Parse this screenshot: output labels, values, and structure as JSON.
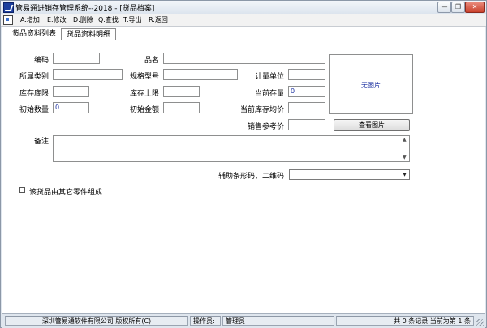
{
  "window": {
    "title": "管易通进销存管理系统--2018 - [货品档案]",
    "minimize_glyph": "—",
    "maximize_glyph": "❐",
    "close_glyph": "✕",
    "icon": "app-logo-icon"
  },
  "menubar": {
    "icon": "document-icon",
    "items": [
      "A.增加",
      "E.修改",
      "D.删除",
      "Q.查找",
      "T.导出",
      "R.返回"
    ]
  },
  "tabs": [
    {
      "label": "货品资料列表",
      "active": false
    },
    {
      "label": "货品资料明细",
      "active": true
    }
  ],
  "form": {
    "code_label": "编码",
    "code_value": "",
    "name_label": "品名",
    "name_value": "",
    "category_label": "所属类别",
    "category_value": "",
    "spec_label": "规格型号",
    "spec_value": "",
    "unit_label": "计量单位",
    "unit_value": "",
    "stock_min_label": "库存底限",
    "stock_min_value": "",
    "stock_max_label": "库存上限",
    "stock_max_value": "",
    "current_stock_label": "当前存量",
    "current_stock_value": "0",
    "init_qty_label": "初始数量",
    "init_qty_value": "0",
    "init_amount_label": "初始金额",
    "init_amount_value": "",
    "avg_price_label": "当前库存均价",
    "avg_price_value": "",
    "sale_ref_label": "销售参考价",
    "sale_ref_value": "",
    "notes_label": "备注",
    "notes_value": "",
    "barcode_label": "辅助条形码、二维码",
    "barcode_value": "",
    "composed_label": "该货品由其它零件组成"
  },
  "photo": {
    "placeholder": "无图片",
    "view_button": "查看图片"
  },
  "status": {
    "company": "深圳管易通软件有限公司 版权所有(C)",
    "operator_label": "操作员:",
    "operator_value": "管理员",
    "records": "共 0 条记录 当前为第 1 条"
  },
  "colors": {
    "value_text": "#1a2fa0",
    "title_bg": "#dce4ee",
    "close_button": "#c9402b"
  }
}
